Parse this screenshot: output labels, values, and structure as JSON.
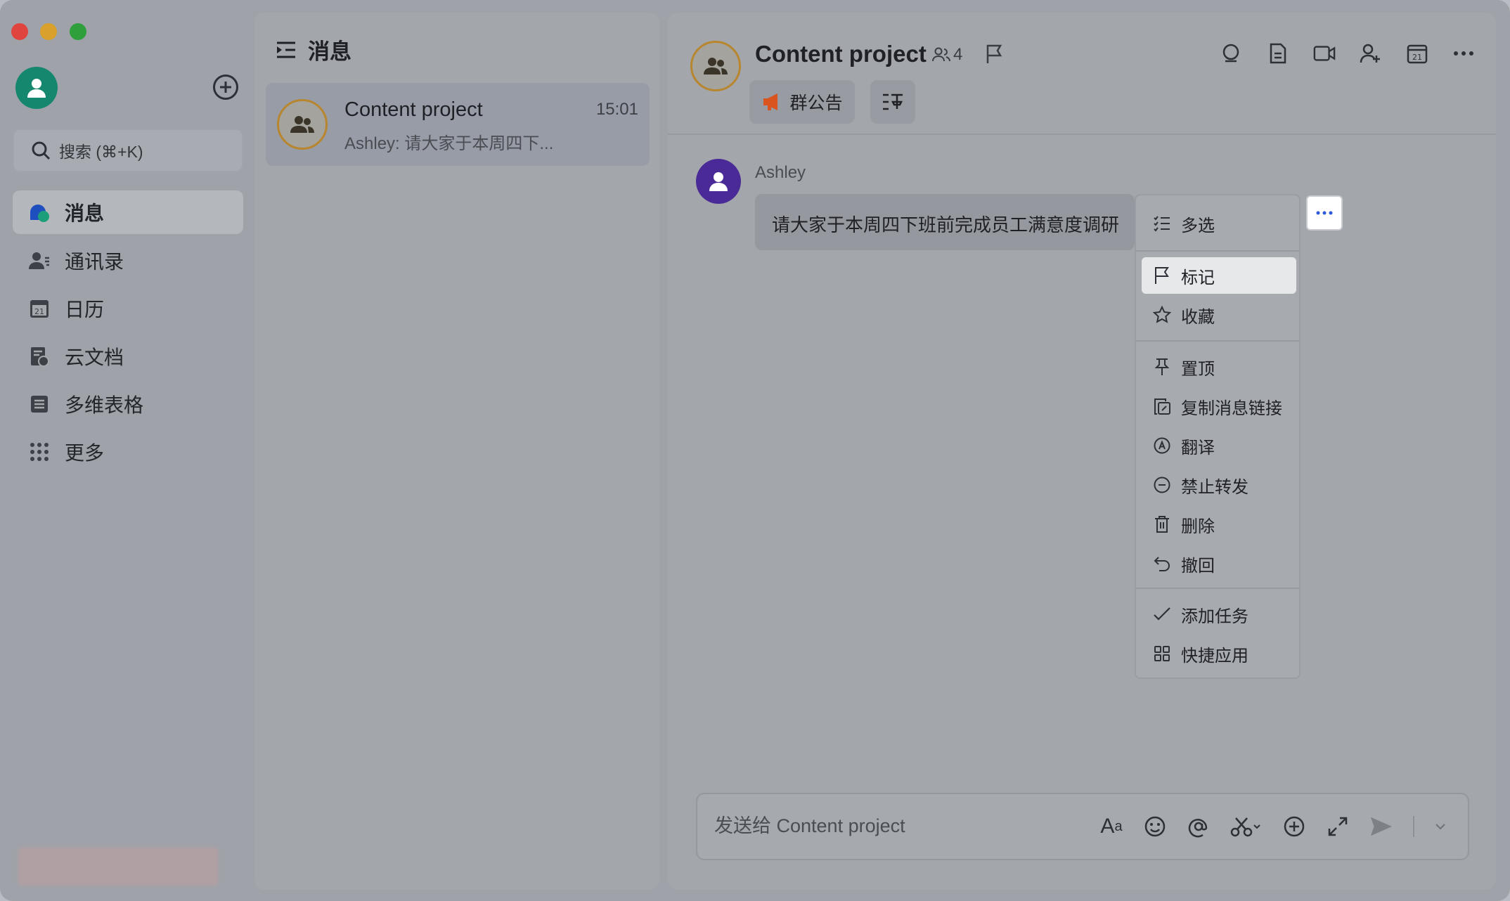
{
  "sidebar": {
    "search_placeholder": "搜索 (⌘+K)",
    "nav": [
      {
        "label": "消息",
        "icon": "messages-icon",
        "active": true
      },
      {
        "label": "通讯录",
        "icon": "contacts-icon",
        "active": false
      },
      {
        "label": "日历",
        "icon": "calendar-icon",
        "active": false
      },
      {
        "label": "云文档",
        "icon": "cloud-docs-icon",
        "active": false
      },
      {
        "label": "多维表格",
        "icon": "base-table-icon",
        "active": false
      },
      {
        "label": "更多",
        "icon": "more-apps-icon",
        "active": false
      }
    ]
  },
  "list": {
    "title": "消息",
    "chats": [
      {
        "name": "Content project",
        "time": "15:01",
        "preview": "Ashley: 请大家于本周四下..."
      }
    ]
  },
  "chat": {
    "title": "Content project",
    "member_count": "4",
    "announcement_label": "群公告",
    "message": {
      "sender": "Ashley",
      "text": "请大家于本周四下班前完成员工满意度调研"
    },
    "composer_placeholder": "发送给 Content project"
  },
  "menu": {
    "items": [
      {
        "label": "多选",
        "icon": "multi-select-icon"
      },
      {
        "label": "标记",
        "icon": "flag-icon"
      },
      {
        "label": "收藏",
        "icon": "star-icon"
      },
      {
        "label": "置顶",
        "icon": "pin-icon"
      },
      {
        "label": "复制消息链接",
        "icon": "copy-link-icon"
      },
      {
        "label": "翻译",
        "icon": "translate-icon"
      },
      {
        "label": "禁止转发",
        "icon": "no-forward-icon"
      },
      {
        "label": "删除",
        "icon": "trash-icon"
      },
      {
        "label": "撤回",
        "icon": "undo-icon"
      },
      {
        "label": "添加任务",
        "icon": "add-task-icon"
      },
      {
        "label": "快捷应用",
        "icon": "quick-apps-icon"
      }
    ],
    "highlighted": "标记"
  },
  "colors": {
    "me_avatar": "#15876e",
    "sender_avatar": "#4a2a96",
    "group_ring": "#b7862f",
    "more_dots": "#2e59d9",
    "megaphone": "#d9541e"
  }
}
